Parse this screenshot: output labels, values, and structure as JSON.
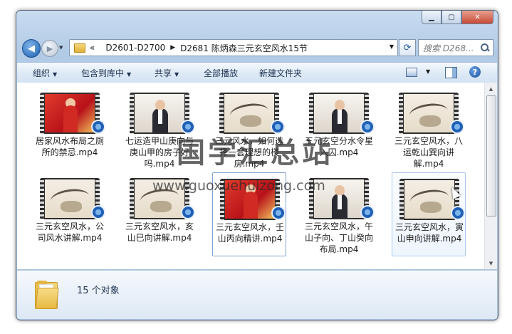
{
  "window": {
    "minimize_label": "▁",
    "maximize_label": "▢",
    "close_label": "✕"
  },
  "address": {
    "overflow": "«",
    "crumbs": [
      "D2601-D2700",
      "D2681 陈炳森三元玄空风水15节"
    ]
  },
  "search": {
    "placeholder": "搜索 D268..."
  },
  "toolbar": {
    "organize": "组织",
    "include_in_library": "包含到库中",
    "share": "共享",
    "play_all": "全部播放",
    "new_folder": "新建文件夹"
  },
  "files": [
    {
      "name": "居家风水布局之厕所的禁忌.mp4",
      "thumb": "red"
    },
    {
      "name": "七运造甲山庚向与庚山甲的房子好吗.mp4",
      "thumb": "white"
    },
    {
      "name": "三元风水，如何选择一套理想的楼房.mp4",
      "thumb": "ink"
    },
    {
      "name": "三元玄空分水令星入囚.mp4",
      "thumb": "white"
    },
    {
      "name": "三元玄空风水，八运乾山巽向讲解.mp4",
      "thumb": "ink"
    },
    {
      "name": "三元玄空风水，公司风水讲解.mp4",
      "thumb": "ink"
    },
    {
      "name": "三元玄空风水，亥山巳向讲解.mp4",
      "thumb": "ink"
    },
    {
      "name": "三元玄空风水，壬山丙向精讲.mp4",
      "thumb": "red"
    },
    {
      "name": "三元玄空风水，午山子向、丁山癸向布局.mp4",
      "thumb": "white"
    },
    {
      "name": "三元玄空风水，寅山申向讲解.mp4",
      "thumb": "ink"
    }
  ],
  "status": {
    "count": "15 个对象"
  },
  "watermark": {
    "text": "国学汇总站",
    "url": "www.guoxuehuizong.com"
  }
}
